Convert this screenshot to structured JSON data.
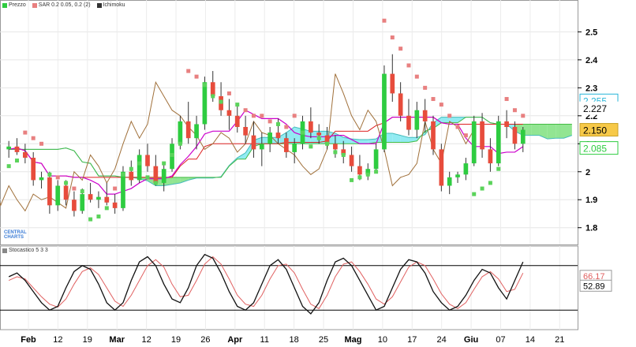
{
  "legend": {
    "price": "Prezzo",
    "sar": "SAR 0.2 0.05, 0.2 (2)",
    "ichimoku": "Ichimoku",
    "stochastic": "Stocastico 5 3 3"
  },
  "logo": {
    "line1": "CENTRAL",
    "line2": "CHARTS"
  },
  "chart_data": [
    {
      "type": "candlestick",
      "title": "",
      "ylim": [
        1.74,
        2.58
      ],
      "ticks": [
        1.8,
        1.9,
        2,
        2.1,
        2.2,
        2.3,
        2.4,
        2.5
      ],
      "tick_labels": [
        "1.8",
        "1.9",
        "2",
        "2.1",
        "2.2",
        "2.3",
        "2.4",
        "2.5"
      ],
      "date_labels": [
        "Feb",
        "12",
        "19",
        "Mar",
        "12",
        "19",
        "26",
        "Apr",
        "11",
        "18",
        "25",
        "Mag",
        "10",
        "17",
        "24",
        "Giu",
        "07",
        "14",
        "21"
      ],
      "candles": [
        [
          2.08,
          2.11,
          2.05,
          2.09
        ],
        [
          2.09,
          2.12,
          2.06,
          2.07
        ],
        [
          2.07,
          2.1,
          2.03,
          2.05
        ],
        [
          2.05,
          2.07,
          1.95,
          1.97
        ],
        [
          1.97,
          2.0,
          1.94,
          1.98
        ],
        [
          1.98,
          2.0,
          1.85,
          1.88
        ],
        [
          1.88,
          1.97,
          1.86,
          1.95
        ],
        [
          1.95,
          1.97,
          1.88,
          1.9
        ],
        [
          1.9,
          1.93,
          1.84,
          1.86
        ],
        [
          1.86,
          1.94,
          1.85,
          1.92
        ],
        [
          1.92,
          1.96,
          1.89,
          1.9
        ],
        [
          1.9,
          1.93,
          1.87,
          1.91
        ],
        [
          1.91,
          1.96,
          1.88,
          1.89
        ],
        [
          1.89,
          1.92,
          1.85,
          1.87
        ],
        [
          1.87,
          2.02,
          1.86,
          2.0
        ],
        [
          2.0,
          2.04,
          1.95,
          1.97
        ],
        [
          1.97,
          2.08,
          1.96,
          2.06
        ],
        [
          2.06,
          2.1,
          2.0,
          2.02
        ],
        [
          2.02,
          2.06,
          1.95,
          1.96
        ],
        [
          1.96,
          2.03,
          1.93,
          2.01
        ],
        [
          2.01,
          2.12,
          2.0,
          2.1
        ],
        [
          2.1,
          2.2,
          2.08,
          2.18
        ],
        [
          2.18,
          2.25,
          2.1,
          2.12
        ],
        [
          2.12,
          2.2,
          2.08,
          2.17
        ],
        [
          2.17,
          2.34,
          2.15,
          2.32
        ],
        [
          2.32,
          2.36,
          2.25,
          2.27
        ],
        [
          2.27,
          2.32,
          2.2,
          2.22
        ],
        [
          2.22,
          2.26,
          2.15,
          2.2
        ],
        [
          2.2,
          2.24,
          2.14,
          2.16
        ],
        [
          2.16,
          2.2,
          2.1,
          2.13
        ],
        [
          2.13,
          2.18,
          2.05,
          2.08
        ],
        [
          2.08,
          2.14,
          2.02,
          2.1
        ],
        [
          2.1,
          2.16,
          2.07,
          2.14
        ],
        [
          2.14,
          2.19,
          2.1,
          2.12
        ],
        [
          2.12,
          2.14,
          2.05,
          2.07
        ],
        [
          2.07,
          2.12,
          2.03,
          2.1
        ],
        [
          2.1,
          2.2,
          2.08,
          2.18
        ],
        [
          2.18,
          2.23,
          2.12,
          2.14
        ],
        [
          2.14,
          2.17,
          2.1,
          2.13
        ],
        [
          2.13,
          2.16,
          2.08,
          2.1
        ],
        [
          2.1,
          2.13,
          2.05,
          2.08
        ],
        [
          2.08,
          2.11,
          2.03,
          2.06
        ],
        [
          2.06,
          2.09,
          2.0,
          2.02
        ],
        [
          2.02,
          2.06,
          1.97,
          1.99
        ],
        [
          1.99,
          2.03,
          1.97,
          2.01
        ],
        [
          2.01,
          2.1,
          2.0,
          2.08
        ],
        [
          2.08,
          2.38,
          2.07,
          2.35
        ],
        [
          2.35,
          2.42,
          2.25,
          2.28
        ],
        [
          2.28,
          2.32,
          2.18,
          2.2
        ],
        [
          2.2,
          2.26,
          2.13,
          2.15
        ],
        [
          2.15,
          2.25,
          2.12,
          2.22
        ],
        [
          2.22,
          2.26,
          2.14,
          2.18
        ],
        [
          2.18,
          2.2,
          2.06,
          2.08
        ],
        [
          2.08,
          2.1,
          1.93,
          1.95
        ],
        [
          1.95,
          2.0,
          1.92,
          1.98
        ],
        [
          1.98,
          2.0,
          1.96,
          1.99
        ],
        [
          1.99,
          2.05,
          1.97,
          2.03
        ],
        [
          2.03,
          2.2,
          2.02,
          2.18
        ],
        [
          2.18,
          2.21,
          2.05,
          2.08
        ],
        [
          2.08,
          2.12,
          2.0,
          2.03
        ],
        [
          2.03,
          2.2,
          2.02,
          2.18
        ],
        [
          2.18,
          2.22,
          2.12,
          2.16
        ],
        [
          2.16,
          2.18,
          2.08,
          2.1
        ],
        [
          2.1,
          2.16,
          2.07,
          2.15
        ]
      ],
      "sar": [
        2.02,
        2.04,
        2.14,
        2.12,
        2.1,
        1.99,
        1.98,
        1.96,
        1.94,
        1.93,
        1.83,
        1.84,
        1.87,
        1.94,
        1.99,
        2.01,
        2.03,
        1.98,
        1.96,
        2.03,
        2.06,
        2.1,
        2.36,
        2.34,
        2.31,
        2.27,
        2.25,
        2.28,
        2.24,
        2.22,
        2.2,
        2.2,
        2.18,
        2.17,
        2.16,
        2.2,
        2.14,
        2.09,
        2.12,
        2.1,
        2.07,
        2.06,
        1.97,
        1.98,
        1.99,
        2.0,
        2.54,
        2.48,
        2.44,
        2.38,
        2.34,
        2.3,
        2.26,
        2.24,
        2.2,
        2.16,
        2.13,
        1.92,
        1.94,
        1.96,
        2.01,
        2.26,
        2.22,
        2.2
      ],
      "annotations": {
        "current_value": "2.150",
        "level_upper": "2.255",
        "level_lower": "2.085",
        "level_mid": "2.227"
      }
    },
    {
      "type": "line",
      "name": "Stocastico 5 3 3",
      "ylim": [
        0,
        100
      ],
      "levels": [
        80,
        20
      ],
      "series": [
        {
          "name": "K",
          "values": [
            65,
            70,
            60,
            45,
            30,
            20,
            25,
            50,
            72,
            80,
            75,
            55,
            30,
            20,
            30,
            60,
            85,
            92,
            80,
            55,
            35,
            30,
            50,
            80,
            95,
            90,
            70,
            45,
            25,
            20,
            30,
            55,
            80,
            88,
            75,
            50,
            25,
            15,
            30,
            60,
            85,
            90,
            80,
            60,
            40,
            20,
            25,
            50,
            75,
            88,
            85,
            70,
            45,
            30,
            20,
            25,
            40,
            60,
            75,
            70,
            50,
            35,
            60,
            85
          ]
        },
        {
          "name": "D",
          "values": [
            60,
            65,
            62,
            50,
            38,
            28,
            24,
            35,
            55,
            72,
            77,
            68,
            50,
            32,
            25,
            40,
            60,
            80,
            88,
            78,
            55,
            38,
            40,
            60,
            82,
            92,
            82,
            62,
            40,
            28,
            25,
            40,
            62,
            80,
            82,
            70,
            48,
            28,
            22,
            40,
            65,
            82,
            85,
            72,
            55,
            35,
            28,
            38,
            58,
            78,
            85,
            80,
            62,
            42,
            28,
            22,
            30,
            48,
            65,
            72,
            62,
            45,
            48,
            70
          ]
        }
      ],
      "annotations": {
        "k_value": "52.89",
        "d_value": "66.17"
      }
    }
  ],
  "colors": {
    "up": "#2ecc40",
    "down": "#e74c3c",
    "sar": "#e88080",
    "cloud_bull": "#7ee8f0",
    "cloud_bear": "#7fe07f",
    "tenkan": "#cc00cc",
    "kijun": "#dd2222",
    "chikou": "#a0703a",
    "stoch_k": "#111111",
    "stoch_d": "#e06060",
    "current_box": "#f7c948"
  }
}
